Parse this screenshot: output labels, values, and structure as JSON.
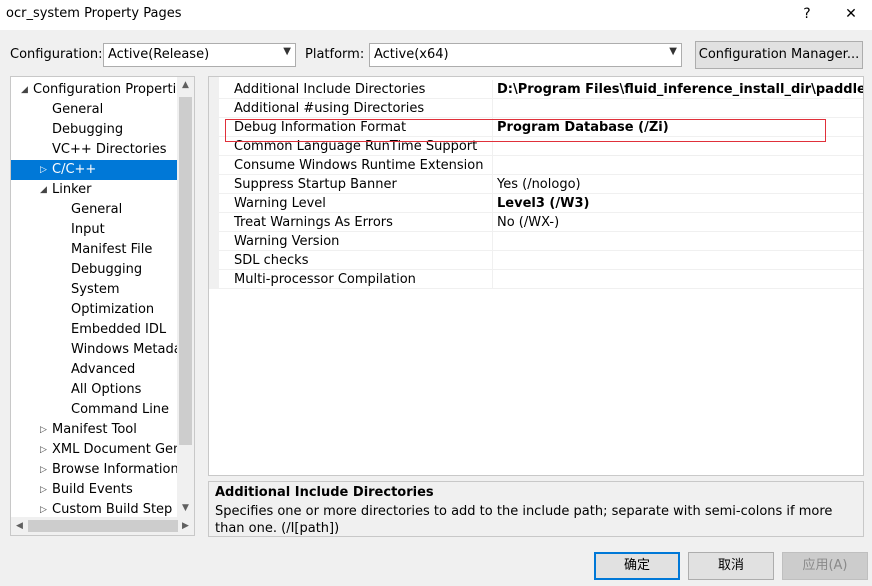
{
  "window": {
    "title": "ocr_system Property Pages",
    "help_glyph": "?",
    "close_glyph": "✕"
  },
  "toolbar": {
    "configuration_label": "Configuration:",
    "configuration_value": "Active(Release)",
    "platform_label": "Platform:",
    "platform_value": "Active(x64)",
    "config_manager_label": "Configuration Manager..."
  },
  "tree": {
    "items": [
      {
        "label": "Configuration Properties",
        "twisty": "◢",
        "level": 0
      },
      {
        "label": "General",
        "twisty": "",
        "level": 1
      },
      {
        "label": "Debugging",
        "twisty": "",
        "level": 1
      },
      {
        "label": "VC++ Directories",
        "twisty": "",
        "level": 1
      },
      {
        "label": "C/C++",
        "twisty": "▷",
        "level": 1,
        "selected": true
      },
      {
        "label": "Linker",
        "twisty": "◢",
        "level": 1
      },
      {
        "label": "General",
        "twisty": "",
        "level": 2
      },
      {
        "label": "Input",
        "twisty": "",
        "level": 2
      },
      {
        "label": "Manifest File",
        "twisty": "",
        "level": 2
      },
      {
        "label": "Debugging",
        "twisty": "",
        "level": 2
      },
      {
        "label": "System",
        "twisty": "",
        "level": 2
      },
      {
        "label": "Optimization",
        "twisty": "",
        "level": 2
      },
      {
        "label": "Embedded IDL",
        "twisty": "",
        "level": 2
      },
      {
        "label": "Windows Metadata",
        "twisty": "",
        "level": 2
      },
      {
        "label": "Advanced",
        "twisty": "",
        "level": 2
      },
      {
        "label": "All Options",
        "twisty": "",
        "level": 2
      },
      {
        "label": "Command Line",
        "twisty": "",
        "level": 2
      },
      {
        "label": "Manifest Tool",
        "twisty": "▷",
        "level": 1
      },
      {
        "label": "XML Document Generator",
        "twisty": "▷",
        "level": 1
      },
      {
        "label": "Browse Information",
        "twisty": "▷",
        "level": 1
      },
      {
        "label": "Build Events",
        "twisty": "▷",
        "level": 1
      },
      {
        "label": "Custom Build Step",
        "twisty": "▷",
        "level": 1
      }
    ]
  },
  "properties": {
    "rows": [
      {
        "name": "Additional Include Directories",
        "value": "D:\\Program Files\\fluid_inference_install_dir\\paddle\\fluid\\inference",
        "bold": true
      },
      {
        "name": "Additional #using Directories",
        "value": "",
        "bold": false
      },
      {
        "name": "Debug Information Format",
        "value": "Program Database (/Zi)",
        "bold": true
      },
      {
        "name": "Common Language RunTime Support",
        "value": "",
        "bold": false
      },
      {
        "name": "Consume Windows Runtime Extension",
        "value": "",
        "bold": false
      },
      {
        "name": "Suppress Startup Banner",
        "value": "Yes (/nologo)",
        "bold": false
      },
      {
        "name": "Warning Level",
        "value": "Level3 (/W3)",
        "bold": true
      },
      {
        "name": "Treat Warnings As Errors",
        "value": "No (/WX-)",
        "bold": false
      },
      {
        "name": "Warning Version",
        "value": "",
        "bold": false
      },
      {
        "name": "SDL checks",
        "value": "",
        "bold": false
      },
      {
        "name": "Multi-processor Compilation",
        "value": "",
        "bold": false
      }
    ]
  },
  "description": {
    "title": "Additional Include Directories",
    "text": "Specifies one or more directories to add to the include path; separate with semi-colons if more than one. (/I[path])"
  },
  "buttons": {
    "ok": "确定",
    "cancel": "取消",
    "apply": "应用(A)"
  },
  "colors": {
    "selection": "#0078d7",
    "highlight_box": "#e0303a"
  }
}
